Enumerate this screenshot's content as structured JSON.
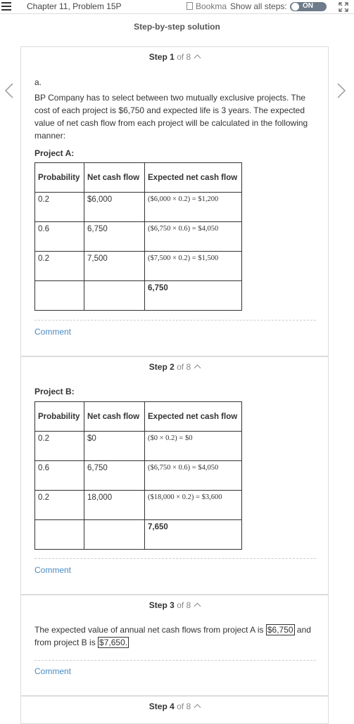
{
  "topbar": {
    "chapter": "Chapter 11, Problem 15P",
    "bookmark": "Bookma",
    "show_all": "Show all steps:",
    "toggle": "ON"
  },
  "heading": "Step-by-step solution",
  "steps": [
    {
      "label": "Step",
      "num": "1",
      "of": "of 8",
      "part": "a.",
      "paragraph": "BP Company has to select between two mutually exclusive projects. The cost of each project is $6,750 and expected life is 3 years. The expected value of net cash flow from each project will be calculated in the following manner:",
      "project": "Project A:",
      "headers": [
        "Probability",
        "Net cash flow",
        "Expected net cash flow"
      ],
      "rows": [
        [
          "0.2",
          "$6,000",
          "($6,000 × 0.2) = $1,200"
        ],
        [
          "0.6",
          "6,750",
          "($6,750 × 0.6) = $4,050"
        ],
        [
          "0.2",
          "7,500",
          "($7,500 × 0.2) = $1,500"
        ],
        [
          "",
          "",
          "6,750"
        ]
      ],
      "comment": "Comment"
    },
    {
      "label": "Step",
      "num": "2",
      "of": "of 8",
      "project": "Project B:",
      "headers": [
        "Probability",
        "Net cash flow",
        "Expected net cash flow"
      ],
      "rows": [
        [
          "0.2",
          "$0",
          "($0 × 0.2) = $0"
        ],
        [
          "0.6",
          "6,750",
          "($6,750 × 0.6) = $4,050"
        ],
        [
          "0.2",
          "18,000",
          "($18,000 × 0.2) = $3,600"
        ],
        [
          "",
          "",
          "7,650"
        ]
      ],
      "comment": "Comment"
    },
    {
      "label": "Step",
      "num": "3",
      "of": "of 8",
      "text_a": "The expected value of annual net cash flows from project A is",
      "value_a": "$6,750",
      "text_b": "and from project B is",
      "value_b": "$7,650.",
      "comment": "Comment"
    },
    {
      "label": "Step",
      "num": "4",
      "of": "of 8"
    }
  ]
}
